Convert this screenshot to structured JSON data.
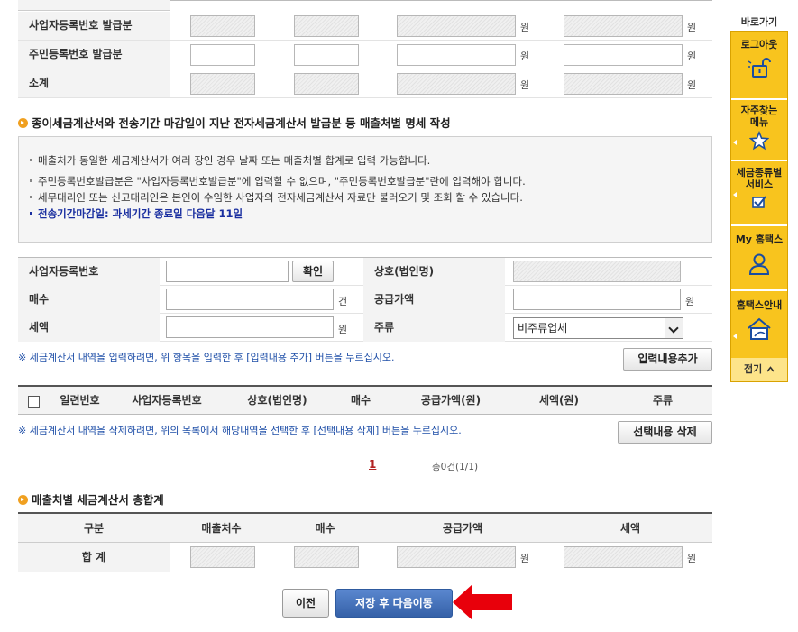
{
  "top_table": {
    "rows": [
      {
        "label": "사업자등록번호 발급분",
        "unit": "원"
      },
      {
        "label": "주민등록번호 발급분",
        "unit": "원"
      },
      {
        "label": "소계",
        "unit": "원"
      }
    ]
  },
  "section1": {
    "title": "종이세금계산서와 전송기간 마감일이 지난 전자세금계산서 발급분 등 매출처별 명세 작성",
    "notices": [
      "매출처가 동일한 세금계산서가 여러 장인 경우 날짜 또는 매출처별 합계로 입력 가능합니다.",
      "주민등록번호발급분은 \"사업자등록번호발급분\"에 입력할 수 없으며, \"주민등록번호발급분\"란에 입력해야 합니다.",
      "세무대리인 또는 신고대리인은 본인이 수임한 사업자의 전자세금계산서 자료만 불러오기 및 조회 할 수 있습니다.",
      "전송기간마감일: 과세기간 종료일 다음달 11일"
    ]
  },
  "form": {
    "biz_no_label": "사업자등록번호",
    "confirm_button": "확인",
    "company_label": "상호(법인명)",
    "count_label": "매수",
    "count_unit": "건",
    "supply_label": "공급가액",
    "supply_unit": "원",
    "tax_label": "세액",
    "tax_unit": "원",
    "kind_label": "주류",
    "kind_selected": "비주류업체",
    "hint_add": "※ 세금계산서 내역을 입력하려면, 위 항목을 입력한 후 [입력내용 추가] 버튼을 누르십시오.",
    "add_button": "입력내용추가"
  },
  "list": {
    "headers": [
      "일련번호",
      "사업자등록번호",
      "상호(법인명)",
      "매수",
      "공급가액(원)",
      "세액(원)",
      "주류"
    ],
    "hint_delete": "※ 세금계산서 내역을 삭제하려면, 위의 목록에서 해당내역을 선택한 후 [선택내용 삭제] 버튼을 누르십시오.",
    "delete_button": "선택내용 삭제",
    "page_number": "1",
    "total_text": "총0건(1/1)"
  },
  "section2": {
    "title": "매출처별 세금계산서 총합계",
    "headers": [
      "구분",
      "매출처수",
      "매수",
      "공급가액",
      "세액"
    ],
    "row_label": "합 계",
    "unit": "원"
  },
  "buttons": {
    "prev": "이전",
    "save_next": "저장 후 다음이동"
  },
  "quickbar": {
    "title": "바로가기",
    "items": [
      "로그아웃",
      "자주찾는 메뉴",
      "세금종류별 서비스",
      "My 홈택스",
      "홈택스안내"
    ],
    "close": "접기",
    "close_icon": "chevron-up-icon"
  },
  "colors": {
    "quickbar": "#f8c41e",
    "notice_highlight": "#1a2fa0",
    "primary_button": "#3d6cb5",
    "arrow": "#e8000b",
    "page_number": "#b22222"
  }
}
